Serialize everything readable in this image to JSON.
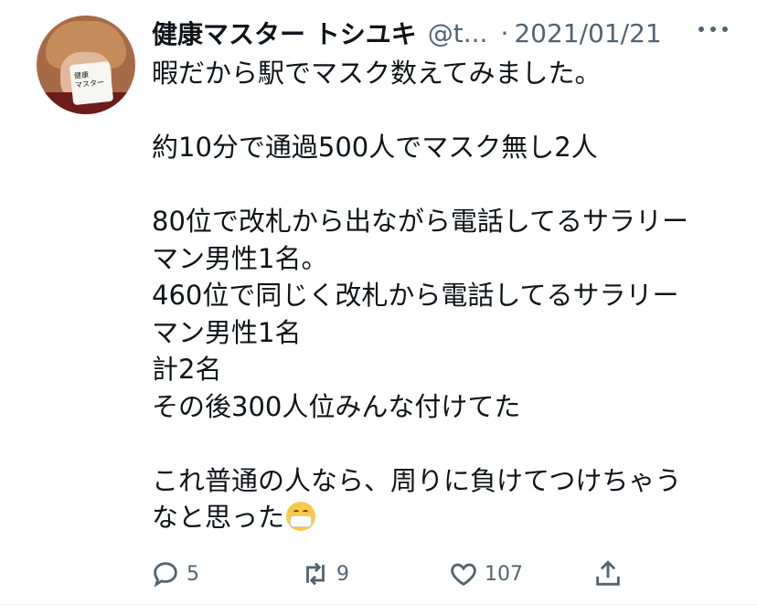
{
  "tweet": {
    "author_name": "健康マスター トシユキ",
    "handle": "@t...",
    "separator": "·",
    "date": "2021/01/21",
    "avatar_card": [
      "健康",
      "マスター"
    ],
    "text_lines": [
      "暇だから駅でマスク数えてみました。",
      "",
      "約10分で通過500人でマスク無し2人",
      "",
      "80位で改札から出ながら電話してるサラリー",
      "マン男性1名。",
      "460位で同じく改札から電話してるサラリー",
      "マン男性1名",
      "計2名",
      "その後300人位みんな付けてた",
      "",
      "これ普通の人なら、周りに負けてつけちゃう",
      "なと思った"
    ],
    "emoji": "face-with-medical-mask",
    "actions": {
      "reply_count": "5",
      "retweet_count": "9",
      "like_count": "107"
    }
  }
}
